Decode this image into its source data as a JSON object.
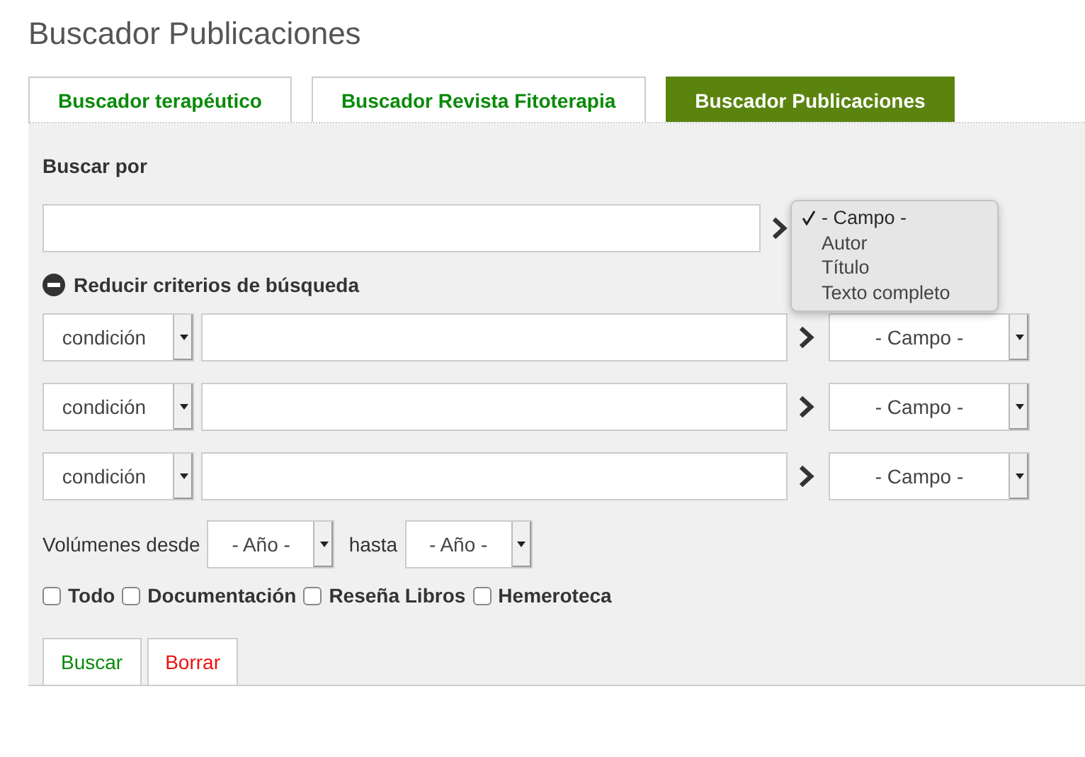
{
  "page_title": "Buscador Publicaciones",
  "tabs": [
    {
      "label": "Buscador terapéutico",
      "selected": false
    },
    {
      "label": "Buscador Revista Fitoterapia",
      "selected": false
    },
    {
      "label": "Buscador Publicaciones",
      "selected": true
    }
  ],
  "search": {
    "label": "Buscar por",
    "field_menu": {
      "options": [
        {
          "label": "- Campo -",
          "selected": true
        },
        {
          "label": "Autor",
          "selected": false
        },
        {
          "label": "Título",
          "selected": false
        },
        {
          "label": "Texto completo",
          "selected": false
        }
      ]
    }
  },
  "reduce_link": "Reducir criterios de búsqueda",
  "criteria": [
    {
      "condition": "condición",
      "field": "- Campo -"
    },
    {
      "condition": "condición",
      "field": "- Campo -"
    },
    {
      "condition": "condición",
      "field": "- Campo -"
    }
  ],
  "volumes": {
    "label": "Volúmenes desde",
    "from": "- Año -",
    "to_label": "hasta",
    "to": "- Año -"
  },
  "filters": [
    {
      "label": "Todo",
      "checked": false
    },
    {
      "label": "Documentación",
      "checked": false
    },
    {
      "label": "Reseña Libros",
      "checked": false
    },
    {
      "label": "Hemeroteca",
      "checked": false
    }
  ],
  "buttons": [
    {
      "label": "Buscar",
      "kind": "submit"
    },
    {
      "label": "Borrar",
      "kind": "reset"
    }
  ]
}
